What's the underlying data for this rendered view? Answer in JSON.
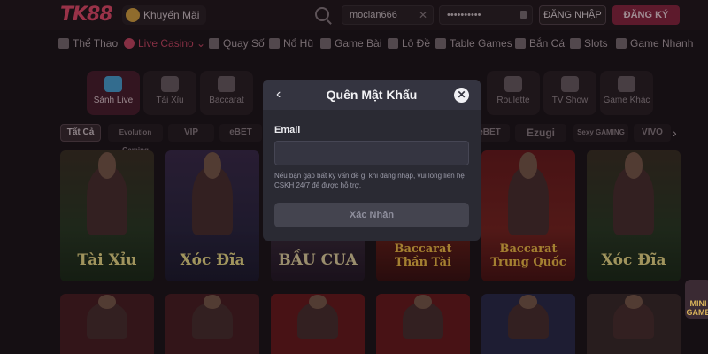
{
  "header": {
    "promo_label": "Khuyến Mãi",
    "username_value": "moclan666",
    "password_value": "••••••••••",
    "login_label": "ĐĂNG NHẬP",
    "register_label": "ĐĂNG KÝ"
  },
  "nav": [
    {
      "label": "Thể Thao",
      "icon": "trophy-icon"
    },
    {
      "label": "Live Casino",
      "icon": "casino-chip-icon",
      "active": true
    },
    {
      "label": "Quay Số",
      "icon": "lottery-icon"
    },
    {
      "label": "Nổ Hũ",
      "icon": "slot-jar-icon"
    },
    {
      "label": "Game Bài",
      "icon": "cards-icon"
    },
    {
      "label": "Lô Đề",
      "icon": "number-icon"
    },
    {
      "label": "Table Games",
      "icon": "table-icon"
    },
    {
      "label": "Bắn Cá",
      "icon": "fish-icon"
    },
    {
      "label": "Slots",
      "icon": "slot-machine-icon"
    },
    {
      "label": "Game Nhanh",
      "icon": "fast-game-icon"
    }
  ],
  "subtabs": [
    {
      "label": "Sảnh Live",
      "active": true
    },
    {
      "label": "Tài Xỉu"
    },
    {
      "label": "Baccarat"
    },
    {
      "label": "Roulette"
    },
    {
      "label": "TV Show"
    },
    {
      "label": "Game Khác"
    }
  ],
  "providers": {
    "all_label": "Tất Cả",
    "items": [
      "Evolution Gaming",
      "VIP",
      "eBET",
      "eBET",
      "Ezugi",
      "Sexy GAMING",
      "VIVO"
    ]
  },
  "cards_row1": [
    {
      "title": "Tài Xỉu",
      "title_color": "#f2e08a"
    },
    {
      "title": "Xóc Đĩa",
      "title_color": "#f2e08a"
    },
    {
      "title": "BẦU CUA",
      "title_color": "#e9d7a4"
    },
    {
      "title": "Baccarat Thần Tài",
      "title_color": "#f7c247"
    },
    {
      "title": "Baccarat Trung Quốc",
      "title_color": "#f7c247"
    },
    {
      "title": "Xóc Đĩa",
      "title_color": "#f2e08a"
    }
  ],
  "modal": {
    "title": "Quên Mật Khẩu",
    "email_label": "Email",
    "email_value": "",
    "note": "Nếu bạn gặp bất kỳ vấn đề gì khi đăng nhập, vui lòng liên hệ CSKH 24/7 để được hỗ trợ.",
    "confirm_label": "Xác Nhận"
  },
  "mini_game_label": "MINI GAME",
  "colors": {
    "accent": "#c84563",
    "modal_bg": "#2a2a33"
  }
}
